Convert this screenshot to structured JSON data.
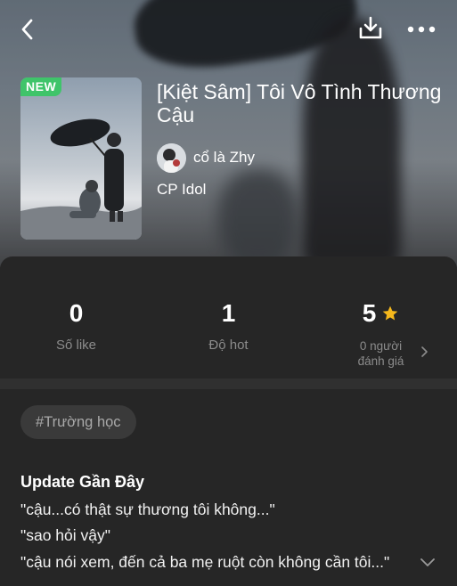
{
  "story": {
    "badge": "NEW",
    "title": "[Kiệt Sâm] Tôi Vô Tình Thương Cậu",
    "author": "cổ là Zhy",
    "category": "CP Idol"
  },
  "stats": {
    "likes": {
      "value": "0",
      "label": "Số like"
    },
    "hot": {
      "value": "1",
      "label": "Độ hot"
    },
    "rating": {
      "value": "5",
      "label_line1": "0 người",
      "label_line2": "đánh giá"
    }
  },
  "tags": [
    "#Trường học"
  ],
  "updates": {
    "title": "Update Gần Đây",
    "lines": [
      "\"cậu...có thật sự thương tôi không...\"",
      "\"sao hỏi vậy\"",
      "\"cậu nói xem, đến cả ba mẹ ruột còn không cần tôi...\""
    ]
  },
  "icons": {
    "back": "chevron-left-icon",
    "download": "download-icon",
    "more": "more-horizontal-icon",
    "star": "star-icon",
    "expand": "chevron-down-icon",
    "rating_detail": "chevron-right-icon"
  },
  "colors": {
    "badge": "#3fc46a",
    "star": "#f5b81c",
    "background": "#262626"
  }
}
